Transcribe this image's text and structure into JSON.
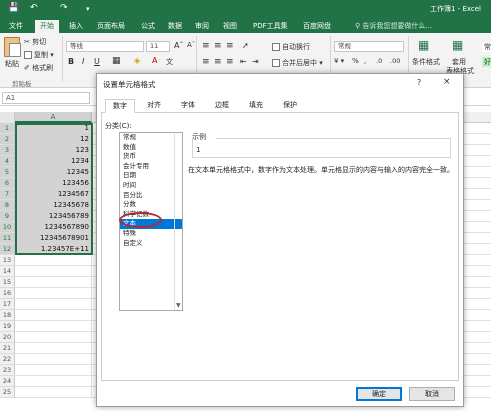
{
  "window": {
    "title": "工作簿1 - Excel"
  },
  "ribbon_tabs": [
    "文件",
    "开始",
    "插入",
    "页面布局",
    "公式",
    "数据",
    "审阅",
    "视图",
    "PDF工具集",
    "百度网盘"
  ],
  "active_tab": "开始",
  "tell_me": "告诉我您想要做什么...",
  "ribbon": {
    "paste": "粘贴",
    "cut": "剪切",
    "copy": "复制",
    "format_painter": "格式刷",
    "clipboard_group": "剪贴板",
    "font_name": "等线",
    "font_size": "11",
    "wrap_text": "自动换行",
    "merge_center": "合并后居中",
    "number_format": "常规",
    "conditional_format": "条件格式",
    "table_format_1": "套用",
    "table_format_2": "表格格式",
    "style_normal": "常",
    "style_good": "好",
    "bold": "B",
    "italic": "I",
    "underline": "U"
  },
  "name_box": "A1",
  "column_header": "A",
  "rows": [
    {
      "n": "1",
      "v": "1"
    },
    {
      "n": "2",
      "v": "12"
    },
    {
      "n": "3",
      "v": "123"
    },
    {
      "n": "4",
      "v": "1234"
    },
    {
      "n": "5",
      "v": "12345"
    },
    {
      "n": "6",
      "v": "123456"
    },
    {
      "n": "7",
      "v": "1234567"
    },
    {
      "n": "8",
      "v": "12345678"
    },
    {
      "n": "9",
      "v": "123456789"
    },
    {
      "n": "10",
      "v": "1234567890"
    },
    {
      "n": "11",
      "v": "12345678901"
    },
    {
      "n": "12",
      "v": "1.23457E+11"
    },
    {
      "n": "13",
      "v": ""
    },
    {
      "n": "14",
      "v": ""
    },
    {
      "n": "15",
      "v": ""
    },
    {
      "n": "16",
      "v": ""
    },
    {
      "n": "17",
      "v": ""
    },
    {
      "n": "18",
      "v": ""
    },
    {
      "n": "19",
      "v": ""
    },
    {
      "n": "20",
      "v": ""
    },
    {
      "n": "21",
      "v": ""
    },
    {
      "n": "22",
      "v": ""
    },
    {
      "n": "23",
      "v": ""
    },
    {
      "n": "24",
      "v": ""
    },
    {
      "n": "25",
      "v": ""
    }
  ],
  "dialog": {
    "title": "设置单元格格式",
    "help": "?",
    "close": "×",
    "tabs": [
      "数字",
      "对齐",
      "字体",
      "边框",
      "填充",
      "保护"
    ],
    "active_tab": "数字",
    "category_label": "分类(C):",
    "categories": [
      "常规",
      "数值",
      "货币",
      "会计专用",
      "日期",
      "时间",
      "百分比",
      "分数",
      "科学记数",
      "文本",
      "特殊",
      "自定义"
    ],
    "selected_category": "文本",
    "sample_label": "示例",
    "sample_value": "1",
    "description": "在文本单元格格式中，数字作为文本处理。单元格显示的内容与输入的内容完全一致。",
    "ok": "确定",
    "cancel": "取消"
  },
  "colors": {
    "accent": "#217346",
    "selection": "#0078d7",
    "highlight_ring": "#b02a3b"
  }
}
